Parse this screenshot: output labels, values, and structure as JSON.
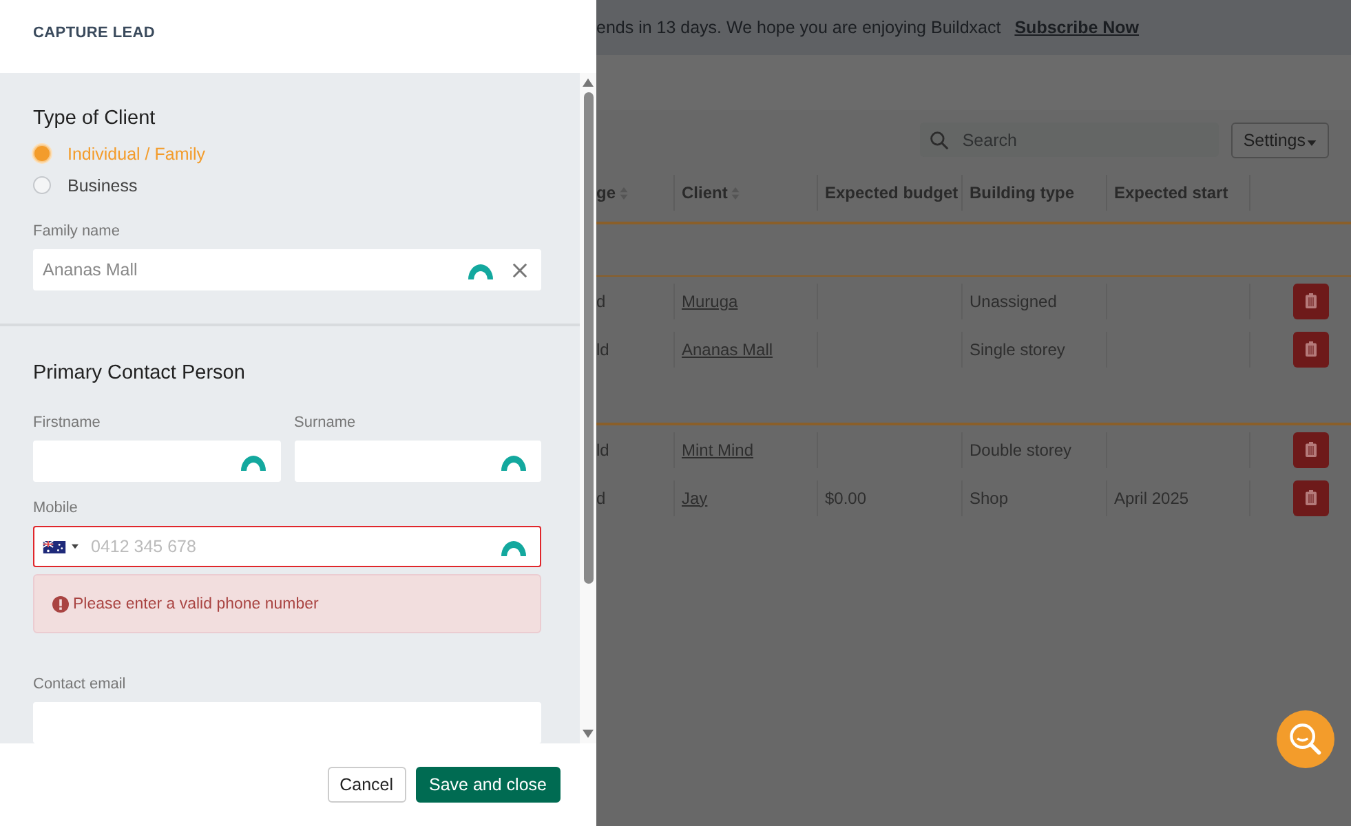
{
  "drawer": {
    "title": "CAPTURE LEAD",
    "client_type": {
      "heading": "Type of Client",
      "options": [
        {
          "label": "Individual / Family",
          "selected": true
        },
        {
          "label": "Business",
          "selected": false
        }
      ]
    },
    "family_name": {
      "label": "Family name",
      "value": "Ananas Mall"
    },
    "contact": {
      "heading": "Primary Contact Person",
      "firstname": {
        "label": "Firstname"
      },
      "surname": {
        "label": "Surname"
      },
      "mobile": {
        "label": "Mobile",
        "placeholder": "0412 345 678",
        "invalid": true,
        "error": "Please enter a valid phone number"
      },
      "email": {
        "label": "Contact email"
      }
    },
    "buttons": [
      {
        "label": "Cancel",
        "kind": "secondary"
      },
      {
        "label": "Save and close",
        "kind": "primary"
      }
    ]
  },
  "background": {
    "banner": {
      "text": "ends in 13 days. We hope you are enjoying Buildxact",
      "link": "Subscribe Now"
    },
    "search": {
      "placeholder": "Search"
    },
    "settings_button": "Settings",
    "table": {
      "columns": [
        {
          "label": "ge",
          "sortable": true
        },
        {
          "label": "Client",
          "sortable": true
        },
        {
          "label": "Expected budget"
        },
        {
          "label": "Building type"
        },
        {
          "label": "Expected start"
        }
      ],
      "groups": [
        {
          "rows": [
            [
              "d",
              "Muruga",
              "",
              "Unassigned",
              ""
            ],
            [
              "ld",
              "Ananas Mall",
              "",
              "Single storey",
              ""
            ]
          ]
        },
        {
          "rows": [
            [
              "ld",
              "Mint Mind",
              "",
              "Double storey",
              ""
            ],
            [
              "d",
              "Jay",
              "$0.00",
              "Shop",
              "April 2025"
            ]
          ]
        }
      ]
    }
  }
}
